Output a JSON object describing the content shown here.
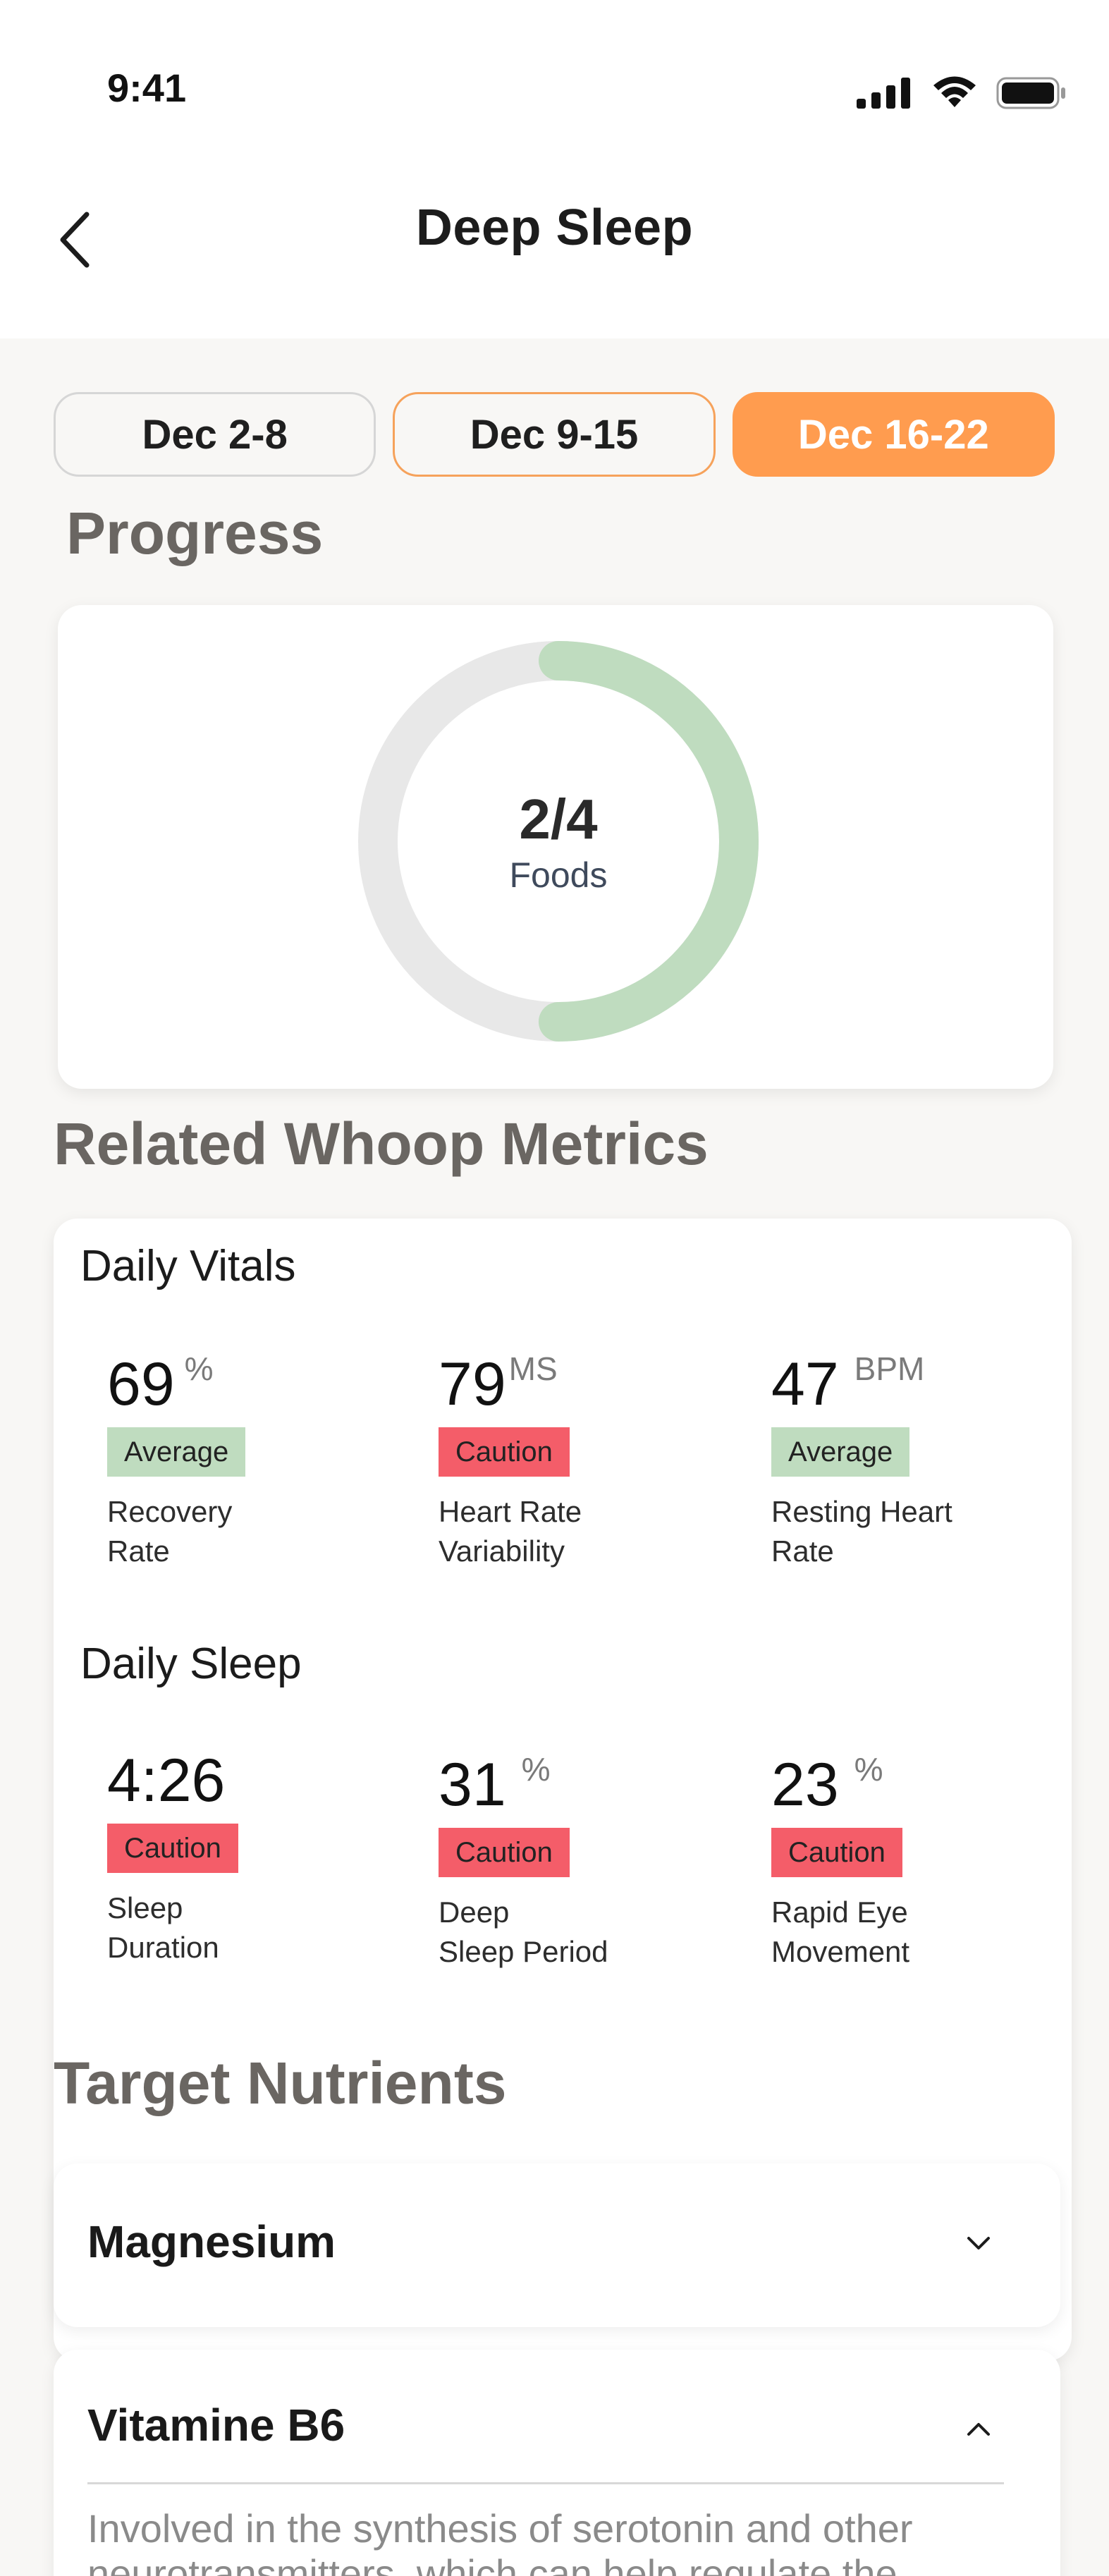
{
  "status": {
    "time": "9:41"
  },
  "header": {
    "title": "Deep Sleep"
  },
  "weeks": [
    {
      "label": "Dec 2-8",
      "state": "default"
    },
    {
      "label": "Dec 9-15",
      "state": "outlined"
    },
    {
      "label": "Dec 16-22",
      "state": "selected"
    }
  ],
  "progress": {
    "title": "Progress",
    "value": "2/4",
    "label": "Foods",
    "fraction": 0.5,
    "colors": {
      "track": "#e8e8e8",
      "fill": "#bfdcbf"
    }
  },
  "metrics": {
    "title": "Related Whoop Metrics",
    "daily_vitals": {
      "heading": "Daily Vitals",
      "items": [
        {
          "value": "69",
          "unit": "%",
          "badge": "Average",
          "status": "average",
          "label": "Recovery\nRate"
        },
        {
          "value": "79",
          "unit": "MS",
          "badge": "Caution",
          "status": "caution",
          "label": "Heart Rate\nVariability"
        },
        {
          "value": "47",
          "unit": "BPM",
          "badge": "Average",
          "status": "average",
          "label": "Resting Heart\nRate"
        }
      ]
    },
    "daily_sleep": {
      "heading": "Daily Sleep",
      "items": [
        {
          "value": "4:26",
          "unit": "",
          "badge": "Caution",
          "status": "caution",
          "label": "Sleep\nDuration"
        },
        {
          "value": "31",
          "unit": "%",
          "badge": "Caution",
          "status": "caution",
          "label": "Deep\nSleep Period"
        },
        {
          "value": "23",
          "unit": "%",
          "badge": "Caution",
          "status": "caution",
          "label": "Rapid Eye\nMovement"
        }
      ]
    }
  },
  "nutrients": {
    "title": "Target Nutrients",
    "items": [
      {
        "name": "Magnesium",
        "expanded": false
      },
      {
        "name": "Vitamine B6",
        "expanded": true,
        "description": "Involved in the synthesis of serotonin and other neurotransmitters, which can help regulate the"
      }
    ]
  },
  "colors": {
    "accent": "#ff9c4f",
    "average": "#bfdcbf",
    "caution": "#f45d69",
    "background": "#f8f7f5"
  }
}
